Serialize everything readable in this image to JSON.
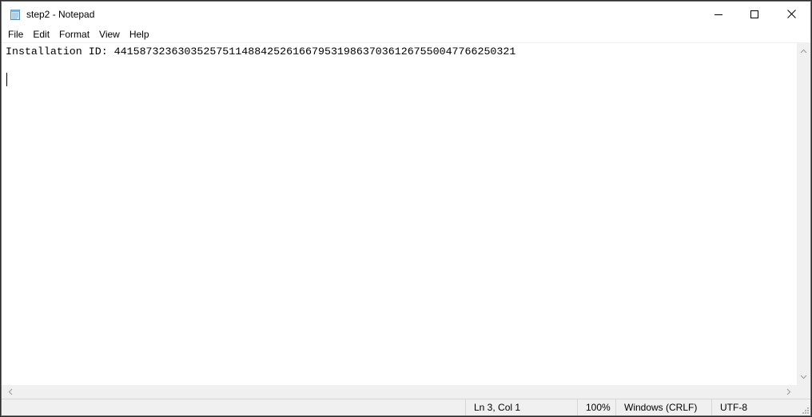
{
  "window": {
    "title": "step2 - Notepad",
    "icon": "notepad-icon",
    "controls": {
      "minimize_icon": "minimize-icon",
      "maximize_icon": "maximize-icon",
      "close_icon": "close-icon"
    }
  },
  "menu": {
    "items": [
      {
        "label": "File"
      },
      {
        "label": "Edit"
      },
      {
        "label": "Format"
      },
      {
        "label": "View"
      },
      {
        "label": "Help"
      }
    ]
  },
  "editor": {
    "line1": "Installation ID: 441587323630352575114884252616679531986370361267550047766250321",
    "line2": "",
    "line3": ""
  },
  "status": {
    "position": "Ln 3, Col 1",
    "zoom": "100%",
    "line_ending": "Windows (CRLF)",
    "encoding": "UTF-8"
  },
  "colors": {
    "window_bg": "#ffffff",
    "chrome_bg": "#f0f0f0",
    "close_hover": "#e81123"
  }
}
